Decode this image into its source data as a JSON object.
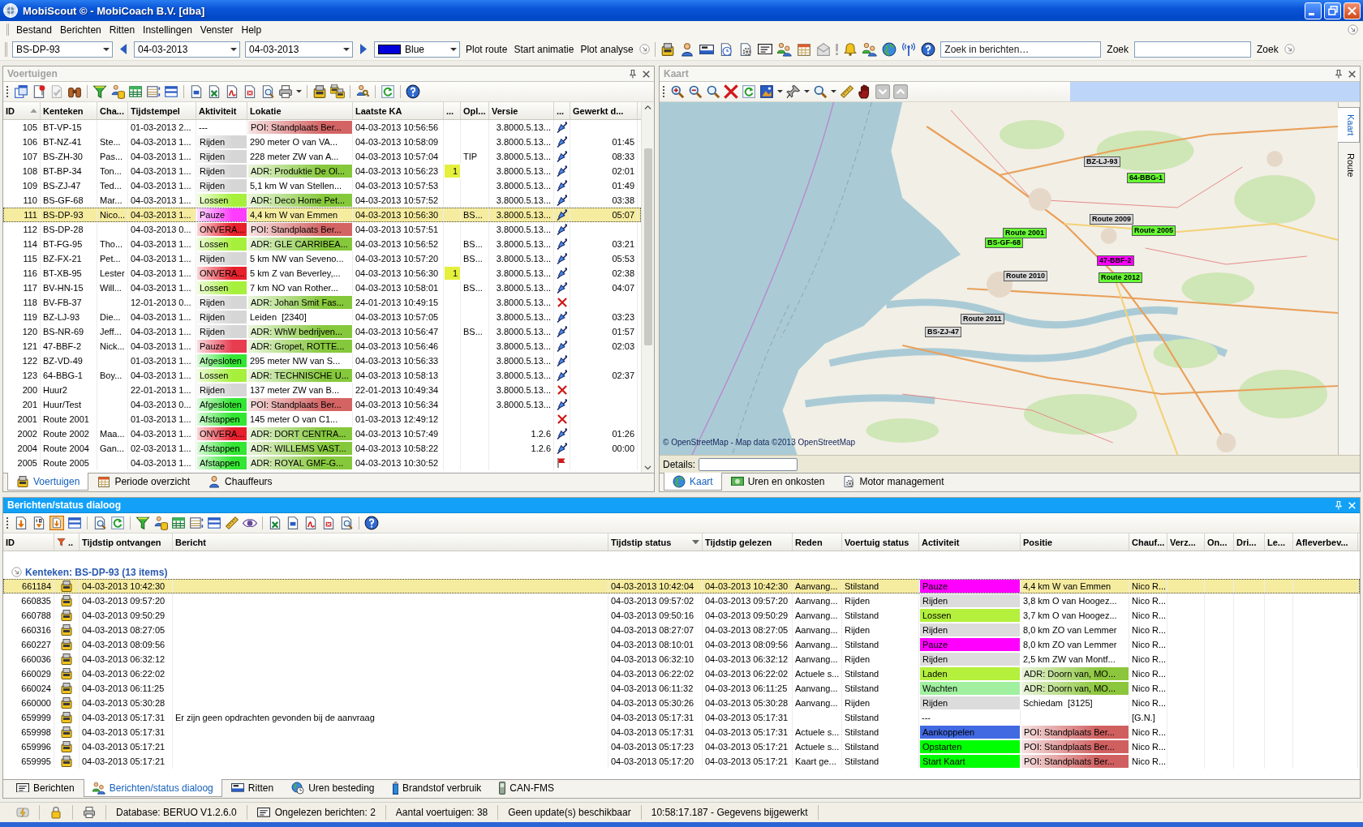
{
  "window": {
    "title": "MobiScout © - MobiCoach B.V. [dba]"
  },
  "menu": [
    "Bestand",
    "Berichten",
    "Ritten",
    "Instellingen",
    "Venster",
    "Help"
  ],
  "toolbar": {
    "vehicle": "BS-DP-93",
    "date_from": "04-03-2013",
    "date_to": "04-03-2013",
    "route_color": "Blue",
    "actions": [
      "Plot route",
      "Start animatie",
      "Plot analyse"
    ],
    "search": [
      {
        "placeholder": "Zoek in berichten…",
        "button": "Zoek"
      },
      {
        "button": "Zoek"
      }
    ]
  },
  "vehicles": {
    "title": "Voertuigen",
    "active": false,
    "columns": [
      {
        "label": "ID",
        "sorted": true,
        "ascending": true
      },
      {
        "label": "Kenteken"
      },
      {
        "label": "Cha..."
      },
      {
        "label": "Tijdstempel"
      },
      {
        "label": "Aktiviteit"
      },
      {
        "label": "Lokatie"
      },
      {
        "label": "Laatste KA"
      },
      {
        "label": "..."
      },
      {
        "label": "Opl..."
      },
      {
        "label": "Versie"
      },
      {
        "label": "..."
      },
      {
        "label": "Gewerkt d..."
      }
    ],
    "rows": [
      {
        "id": "105",
        "kenteken": "BT-VP-15",
        "tijdstempel": "01-03-2013 2...",
        "aktiviteit": {
          "text": "---"
        },
        "lokatie": {
          "text": "POI: Standplaats Ber...",
          "color": "#d46464"
        },
        "laatste_ka": "04-03-2013 10:56:56",
        "versie": "3.8000.5.13...",
        "column_11": {
          "kind": "pen"
        },
        "selected": false
      },
      {
        "id": "106",
        "kenteken": "BT-NZ-41",
        "column_3": "Ste...",
        "tijdstempel": "04-03-2013 1...",
        "aktiviteit": {
          "text": "Rijden",
          "color": "#d6d6d6"
        },
        "lokatie": {
          "text": "290 meter O van VA..."
        },
        "laatste_ka": "04-03-2013 10:58:09",
        "versie": "3.8000.5.13...",
        "column_11": {
          "kind": "pen"
        },
        "column_12": "01:45",
        "selected": false
      },
      {
        "id": "107",
        "kenteken": "BS-ZH-30",
        "column_3": "Pas...",
        "tijdstempel": "04-03-2013 1...",
        "aktiviteit": {
          "text": "Rijden",
          "color": "#d6d6d6"
        },
        "lokatie": {
          "text": "228 meter ZW van A..."
        },
        "laatste_ka": "04-03-2013 10:57:04",
        "column_9": "TIP",
        "versie": "3.8000.5.13...",
        "column_11": {
          "kind": "pen"
        },
        "column_12": "08:33",
        "selected": false
      },
      {
        "id": "108",
        "kenteken": "BT-BP-34",
        "column_3": "Ton...",
        "tijdstempel": "04-03-2013 1...",
        "aktiviteit": {
          "text": "Rijden",
          "color": "#d6d6d6"
        },
        "lokatie": {
          "text": "ADR: Produktie De Ol...",
          "color": "#86c83c"
        },
        "laatste_ka": "04-03-2013 10:56:23",
        "column_8": "1",
        "versie": "3.8000.5.13...",
        "column_11": {
          "kind": "pen"
        },
        "column_12": "02:01",
        "selected": false
      },
      {
        "id": "109",
        "kenteken": "BS-ZJ-47",
        "column_3": "Ted...",
        "tijdstempel": "04-03-2013 1...",
        "aktiviteit": {
          "text": "Rijden",
          "color": "#d6d6d6"
        },
        "lokatie": {
          "text": "5,1 km W van Stellen..."
        },
        "laatste_ka": "04-03-2013 10:57:53",
        "versie": "3.8000.5.13...",
        "column_11": {
          "kind": "pen"
        },
        "column_12": "01:49",
        "selected": false
      },
      {
        "id": "110",
        "kenteken": "BS-GF-68",
        "column_3": "Mar...",
        "tijdstempel": "04-03-2013 1...",
        "aktiviteit": {
          "text": "Lossen",
          "color": "#a6f03c"
        },
        "lokatie": {
          "text": "ADR: Deco Home Pet...",
          "color": "#86c83c"
        },
        "laatste_ka": "04-03-2013 10:57:52",
        "versie": "3.8000.5.13...",
        "column_11": {
          "kind": "pen"
        },
        "column_12": "03:38",
        "selected": false
      },
      {
        "id": "111",
        "kenteken": "BS-DP-93",
        "column_3": "Nico...",
        "tijdstempel": "04-03-2013 1...",
        "aktiviteit": {
          "text": "Pauze",
          "color": "#ff3cff"
        },
        "lokatie": {
          "text": "4,4 km W van Emmen"
        },
        "laatste_ka": "04-03-2013 10:56:30",
        "column_9": "BS...",
        "versie": "3.8000.5.13...",
        "column_11": {
          "kind": "pen"
        },
        "column_12": "05:07",
        "selected": true
      },
      {
        "id": "112",
        "kenteken": "BS-DP-28",
        "tijdstempel": "04-03-2013 0...",
        "aktiviteit": {
          "text": "ONVERA...",
          "color": "#e8202c"
        },
        "lokatie": {
          "text": "POI: Standplaats Ber...",
          "color": "#d46464"
        },
        "laatste_ka": "04-03-2013 10:57:51",
        "versie": "3.8000.5.13...",
        "column_11": {
          "kind": "pen"
        },
        "selected": false
      },
      {
        "id": "114",
        "kenteken": "BT-FG-95",
        "column_3": "Tho...",
        "tijdstempel": "04-03-2013 1...",
        "aktiviteit": {
          "text": "Lossen",
          "color": "#a6f03c"
        },
        "lokatie": {
          "text": "ADR: GLE CARRIBEA...",
          "color": "#86c83c"
        },
        "laatste_ka": "04-03-2013 10:56:52",
        "column_9": "BS...",
        "versie": "3.8000.5.13...",
        "column_11": {
          "kind": "pen"
        },
        "column_12": "03:21",
        "selected": false
      },
      {
        "id": "115",
        "kenteken": "BZ-FX-21",
        "column_3": "Pet...",
        "tijdstempel": "04-03-2013 1...",
        "aktiviteit": {
          "text": "Rijden",
          "color": "#d6d6d6"
        },
        "lokatie": {
          "text": "5 km NW van Seveno..."
        },
        "laatste_ka": "04-03-2013 10:57:20",
        "column_9": "BS...",
        "versie": "3.8000.5.13...",
        "column_11": {
          "kind": "pen"
        },
        "column_12": "05:53",
        "selected": false
      },
      {
        "id": "116",
        "kenteken": "BT-XB-95",
        "column_3": "Lester",
        "tijdstempel": "04-03-2013 1...",
        "aktiviteit": {
          "text": "ONVERA...",
          "color": "#e8202c"
        },
        "lokatie": {
          "text": "5 km Z van Beverley,..."
        },
        "laatste_ka": "04-03-2013 10:56:30",
        "column_8": "1",
        "versie": "3.8000.5.13...",
        "column_11": {
          "kind": "pen"
        },
        "column_12": "02:38",
        "selected": false
      },
      {
        "id": "117",
        "kenteken": "BV-HN-15",
        "column_3": "Will...",
        "tijdstempel": "04-03-2013 1...",
        "aktiviteit": {
          "text": "Lossen",
          "color": "#a6f03c"
        },
        "lokatie": {
          "text": "7 km NO van Rother..."
        },
        "laatste_ka": "04-03-2013 10:58:01",
        "column_9": "BS...",
        "versie": "3.8000.5.13...",
        "column_11": {
          "kind": "pen"
        },
        "column_12": "04:07",
        "selected": false
      },
      {
        "id": "118",
        "kenteken": "BV-FB-37",
        "tijdstempel": "12-01-2013 0...",
        "aktiviteit": {
          "text": "Rijden",
          "color": "#d6d6d6"
        },
        "lokatie": {
          "text": "ADR: Johan Smit Fas...",
          "color": "#86c83c"
        },
        "laatste_ka": "24-01-2013 10:49:15",
        "versie": "3.8000.5.13...",
        "column_11": {
          "kind": "cross"
        },
        "selected": false
      },
      {
        "id": "119",
        "kenteken": "BZ-LJ-93",
        "column_3": "Die...",
        "tijdstempel": "04-03-2013 1...",
        "aktiviteit": {
          "text": "Rijden",
          "color": "#d6d6d6"
        },
        "lokatie": {
          "text": "Leiden  [2340]"
        },
        "laatste_ka": "04-03-2013 10:57:05",
        "versie": "3.8000.5.13...",
        "column_11": {
          "kind": "pen"
        },
        "column_12": "03:23",
        "selected": false
      },
      {
        "id": "120",
        "kenteken": "BS-NR-69",
        "column_3": "Jeff...",
        "tijdstempel": "04-03-2013 1...",
        "aktiviteit": {
          "text": "Rijden",
          "color": "#d6d6d6"
        },
        "lokatie": {
          "text": "ADR: WhW bedrijven...",
          "color": "#86c83c"
        },
        "laatste_ka": "04-03-2013 10:56:47",
        "column_9": "BS...",
        "versie": "3.8000.5.13...",
        "column_11": {
          "kind": "pen"
        },
        "column_12": "01:57",
        "selected": false
      },
      {
        "id": "121",
        "kenteken": "47-BBF-2",
        "column_3": "Nick...",
        "tijdstempel": "04-03-2013 1...",
        "aktiviteit": {
          "text": "Pauze",
          "color": "#e83c50"
        },
        "lokatie": {
          "text": "ADR: Gropet, ROTTE...",
          "color": "#86c83c"
        },
        "laatste_ka": "04-03-2013 10:56:46",
        "versie": "3.8000.5.13...",
        "column_11": {
          "kind": "pen"
        },
        "column_12": "02:03",
        "selected": false
      },
      {
        "id": "122",
        "kenteken": "BZ-VD-49",
        "tijdstempel": "01-03-2013 1...",
        "aktiviteit": {
          "text": "Afgesloten",
          "color": "#32e632"
        },
        "lokatie": {
          "text": "295 meter NW van S..."
        },
        "laatste_ka": "04-03-2013 10:56:33",
        "versie": "3.8000.5.13...",
        "column_11": {
          "kind": "pen"
        },
        "selected": false
      },
      {
        "id": "123",
        "kenteken": "64-BBG-1",
        "column_3": "Boy...",
        "tijdstempel": "04-03-2013 1...",
        "aktiviteit": {
          "text": "Lossen",
          "color": "#a6f03c"
        },
        "lokatie": {
          "text": "ADR: TECHNISCHE U...",
          "color": "#86c83c"
        },
        "laatste_ka": "04-03-2013 10:58:13",
        "versie": "3.8000.5.13...",
        "column_11": {
          "kind": "pen"
        },
        "column_12": "02:37",
        "selected": false
      },
      {
        "id": "200",
        "kenteken": "Huur2",
        "tijdstempel": "22-01-2013 1...",
        "aktiviteit": {
          "text": "Rijden",
          "color": "#d6d6d6"
        },
        "lokatie": {
          "text": "137 meter ZW van B..."
        },
        "laatste_ka": "22-01-2013 10:49:34",
        "versie": "3.8000.5.13...",
        "column_11": {
          "kind": "cross"
        },
        "selected": false
      },
      {
        "id": "201",
        "kenteken": "Huur/Test",
        "tijdstempel": "04-03-2013 0...",
        "aktiviteit": {
          "text": "Afgesloten",
          "color": "#32e632"
        },
        "lokatie": {
          "text": "POI: Standplaats Ber...",
          "color": "#d46464"
        },
        "laatste_ka": "04-03-2013 10:56:34",
        "versie": "3.8000.5.13...",
        "column_11": {
          "kind": "pen"
        },
        "selected": false
      },
      {
        "id": "2001",
        "kenteken": "Route 2001",
        "tijdstempel": "01-03-2013 1...",
        "aktiviteit": {
          "text": "Afstappen",
          "color": "#32e632"
        },
        "lokatie": {
          "text": "145 meter O van C1..."
        },
        "laatste_ka": "01-03-2013 12:49:12",
        "column_11": {
          "kind": "cross"
        },
        "selected": false
      },
      {
        "id": "2002",
        "kenteken": "Route 2002",
        "column_3": "Maa...",
        "tijdstempel": "04-03-2013 1...",
        "aktiviteit": {
          "text": "ONVERA...",
          "color": "#e8202c"
        },
        "lokatie": {
          "text": "ADR: DORT CENTRA...",
          "color": "#86c83c"
        },
        "laatste_ka": "04-03-2013 10:57:49",
        "versie": "1.2.6",
        "column_11": {
          "kind": "pen"
        },
        "column_12": "01:26",
        "selected": false
      },
      {
        "id": "2004",
        "kenteken": "Route 2004",
        "column_3": "Gan...",
        "tijdstempel": "02-03-2013 1...",
        "aktiviteit": {
          "text": "Afstappen",
          "color": "#32e632"
        },
        "lokatie": {
          "text": "ADR: WILLEMS VAST...",
          "color": "#86c83c"
        },
        "laatste_ka": "04-03-2013 10:58:22",
        "versie": "1.2.6",
        "column_11": {
          "kind": "pen"
        },
        "column_12": "00:00",
        "selected": false
      },
      {
        "id": "2005",
        "kenteken": "Route 2005",
        "tijdstempel": "04-03-2013 1...",
        "aktiviteit": {
          "text": "Afstappen",
          "color": "#32e632"
        },
        "lokatie": {
          "text": "ADR: ROYAL GMF-G...",
          "color": "#86c83c"
        },
        "laatste_ka": "04-03-2013 10:30:52",
        "column_11": {
          "kind": "flag"
        },
        "selected": false
      }
    ],
    "tabs": [
      {
        "label": "Voertuigen",
        "selected": true
      },
      {
        "label": "Periode overzicht",
        "selected": false
      },
      {
        "label": "Chauffeurs",
        "selected": false
      }
    ]
  },
  "map": {
    "title": "Kaart",
    "active": false,
    "side_tabs": [
      {
        "label": "Kaart",
        "selected": true
      },
      {
        "label": "Route",
        "selected": false
      }
    ],
    "markers": [
      {
        "label": "BZ-LJ-93",
        "color": "#d8d8d8"
      },
      {
        "label": "64-BBG-1",
        "color": "#66ff33"
      },
      {
        "label": "BS-GF-68",
        "color": "#66ff33"
      },
      {
        "label": "47-BBF-2",
        "color": "#ff00ff"
      },
      {
        "label": "BS-ZJ-47",
        "color": "#d8d8d8"
      },
      {
        "label": "Route 2001",
        "color": "#66ff33"
      },
      {
        "label": "Route 2005",
        "color": "#66ff33"
      },
      {
        "label": "Route 2010",
        "color": "#d8d8d8"
      },
      {
        "label": "Route 2012",
        "color": "#66ff33"
      },
      {
        "label": "Route 2011",
        "color": "#d8d8d8"
      },
      {
        "label": "Route 2009",
        "color": "#d8d8d8"
      }
    ],
    "attribution": "© OpenStreetMap - Map data ©2013 OpenStreetMap",
    "details_label": "Details:",
    "tabs": [
      {
        "label": "Kaart",
        "selected": true
      },
      {
        "label": "Uren en onkosten",
        "selected": false
      },
      {
        "label": "Motor management",
        "selected": false
      }
    ]
  },
  "messages": {
    "title": "Berichten/status dialoog",
    "active": true,
    "columns": [
      {
        "label": "ID"
      },
      {
        "label": ".."
      },
      {
        "label": "Tijdstip ontvangen"
      },
      {
        "label": "Bericht"
      },
      {
        "label": "Tijdstip status",
        "sorted": true,
        "ascending": false
      },
      {
        "label": "Tijdstip gelezen"
      },
      {
        "label": "Reden"
      },
      {
        "label": "Voertuig status"
      },
      {
        "label": "Activiteit"
      },
      {
        "label": "Positie"
      },
      {
        "label": "Chauf..."
      },
      {
        "label": "Verz..."
      },
      {
        "label": "On..."
      },
      {
        "label": "Dri..."
      },
      {
        "label": "Le..."
      },
      {
        "label": "Afleverbev..."
      }
    ],
    "group": {
      "label": "Kenteken: BS-DP-93 (13 items)",
      "expanded": true
    },
    "rows": [
      {
        "id": "661184",
        "tijdstip_ontvangen": "04-03-2013 10:42:30",
        "tijdstip_status": "04-03-2013 10:42:04",
        "tijdstip_gelezen": "04-03-2013 10:42:30",
        "reden": "Aanvang...",
        "voertuig_status": "Stilstand",
        "activiteit": {
          "text": "Pauze",
          "color": "#ff00ff"
        },
        "positie": {
          "text": "4,4 km W van Emmen"
        },
        "column_11": "Nico R...",
        "selected": true
      },
      {
        "id": "660835",
        "tijdstip_ontvangen": "04-03-2013 09:57:20",
        "tijdstip_status": "04-03-2013 09:57:02",
        "tijdstip_gelezen": "04-03-2013 09:57:20",
        "reden": "Aanvang...",
        "voertuig_status": "Rijden",
        "activiteit": {
          "text": "Rijden",
          "color": "#dcdcdc"
        },
        "positie": {
          "text": "3,8 km O van Hoogez..."
        },
        "column_11": "Nico R...",
        "selected": false
      },
      {
        "id": "660788",
        "tijdstip_ontvangen": "04-03-2013 09:50:29",
        "tijdstip_status": "04-03-2013 09:50:16",
        "tijdstip_gelezen": "04-03-2013 09:50:29",
        "reden": "Aanvang...",
        "voertuig_status": "Stilstand",
        "activiteit": {
          "text": "Lossen",
          "color": "#b4f03c"
        },
        "positie": {
          "text": "3,7 km O van Hoogez..."
        },
        "column_11": "Nico R...",
        "selected": false
      },
      {
        "id": "660316",
        "tijdstip_ontvangen": "04-03-2013 08:27:05",
        "tijdstip_status": "04-03-2013 08:27:07",
        "tijdstip_gelezen": "04-03-2013 08:27:05",
        "reden": "Aanvang...",
        "voertuig_status": "Rijden",
        "activiteit": {
          "text": "Rijden",
          "color": "#dcdcdc"
        },
        "positie": {
          "text": "8,0 km ZO van Lemmer"
        },
        "column_11": "Nico R...",
        "selected": false
      },
      {
        "id": "660227",
        "tijdstip_ontvangen": "04-03-2013 08:09:56",
        "tijdstip_status": "04-03-2013 08:10:01",
        "tijdstip_gelezen": "04-03-2013 08:09:56",
        "reden": "Aanvang...",
        "voertuig_status": "Stilstand",
        "activiteit": {
          "text": "Pauze",
          "color": "#ff00ff"
        },
        "positie": {
          "text": "8,0 km ZO van Lemmer"
        },
        "column_11": "Nico R...",
        "selected": false
      },
      {
        "id": "660036",
        "tijdstip_ontvangen": "04-03-2013 06:32:12",
        "tijdstip_status": "04-03-2013 06:32:10",
        "tijdstip_gelezen": "04-03-2013 06:32:12",
        "reden": "Aanvang...",
        "voertuig_status": "Rijden",
        "activiteit": {
          "text": "Rijden",
          "color": "#dcdcdc"
        },
        "positie": {
          "text": "2,5 km ZW van Montf..."
        },
        "column_11": "Nico R...",
        "selected": false
      },
      {
        "id": "660029",
        "tijdstip_ontvangen": "04-03-2013 06:22:02",
        "tijdstip_status": "04-03-2013 06:22:02",
        "tijdstip_gelezen": "04-03-2013 06:22:02",
        "reden": "Actuele s...",
        "voertuig_status": "Stilstand",
        "activiteit": {
          "text": "Laden",
          "color": "#b4f03c"
        },
        "positie": {
          "text": "ADR: Doorn van, MO...",
          "color": "#8cc63c"
        },
        "column_11": "Nico R...",
        "selected": false
      },
      {
        "id": "660024",
        "tijdstip_ontvangen": "04-03-2013 06:11:25",
        "tijdstip_status": "04-03-2013 06:11:32",
        "tijdstip_gelezen": "04-03-2013 06:11:25",
        "reden": "Aanvang...",
        "voertuig_status": "Stilstand",
        "activiteit": {
          "text": "Wachten",
          "color": "#a0f0a0"
        },
        "positie": {
          "text": "ADR: Doorn van, MO...",
          "color": "#8cc63c"
        },
        "column_11": "Nico R...",
        "selected": false
      },
      {
        "id": "660000",
        "tijdstip_ontvangen": "04-03-2013 05:30:28",
        "tijdstip_status": "04-03-2013 05:30:26",
        "tijdstip_gelezen": "04-03-2013 05:30:28",
        "reden": "Aanvang...",
        "voertuig_status": "Rijden",
        "activiteit": {
          "text": "Rijden",
          "color": "#dcdcdc"
        },
        "positie": {
          "text": "Schiedam  [3125]"
        },
        "column_11": "Nico R...",
        "selected": false
      },
      {
        "id": "659999",
        "tijdstip_ontvangen": "04-03-2013 05:17:31",
        "bericht": "Er zijn geen opdrachten gevonden bij de aanvraag",
        "tijdstip_status": "04-03-2013 05:17:31",
        "tijdstip_gelezen": "04-03-2013 05:17:31",
        "voertuig_status": "Stilstand",
        "activiteit": {
          "text": "---"
        },
        "column_11": "[G.N.]",
        "selected": false
      },
      {
        "id": "659998",
        "tijdstip_ontvangen": "04-03-2013 05:17:31",
        "tijdstip_status": "04-03-2013 05:17:31",
        "tijdstip_gelezen": "04-03-2013 05:17:31",
        "reden": "Actuele s...",
        "voertuig_status": "Stilstand",
        "activiteit": {
          "text": "Aankoppelen",
          "color": "#4169e1"
        },
        "positie": {
          "text": "POI: Standplaats Ber...",
          "color": "#d06060"
        },
        "column_11": "Nico R...",
        "selected": false
      },
      {
        "id": "659996",
        "tijdstip_ontvangen": "04-03-2013 05:17:21",
        "tijdstip_status": "04-03-2013 05:17:23",
        "tijdstip_gelezen": "04-03-2013 05:17:21",
        "reden": "Actuele s...",
        "voertuig_status": "Stilstand",
        "activiteit": {
          "text": "Opstarten",
          "color": "#00ff00"
        },
        "positie": {
          "text": "POI: Standplaats Ber...",
          "color": "#d06060"
        },
        "column_11": "Nico R...",
        "selected": false
      },
      {
        "id": "659995",
        "tijdstip_ontvangen": "04-03-2013 05:17:21",
        "tijdstip_status": "04-03-2013 05:17:20",
        "tijdstip_gelezen": "04-03-2013 05:17:21",
        "reden": "Kaart ge...",
        "voertuig_status": "Stilstand",
        "activiteit": {
          "text": "Start Kaart",
          "color": "#00ff00"
        },
        "positie": {
          "text": "POI: Standplaats Ber...",
          "color": "#d06060"
        },
        "column_11": "Nico R...",
        "selected": false
      }
    ],
    "tabs": [
      {
        "label": "Berichten",
        "selected": false
      },
      {
        "label": "Berichten/status dialoog",
        "selected": true
      },
      {
        "label": "Ritten",
        "selected": false
      },
      {
        "label": "Uren besteding",
        "selected": false
      },
      {
        "label": "Brandstof verbruik",
        "selected": false
      },
      {
        "label": "CAN-FMS",
        "selected": false
      }
    ]
  },
  "status_bar": [
    {
      "text": "Database: BERUO V1.2.6.0",
      "kind": "text"
    },
    {
      "text": "Ongelezen berichten: 2",
      "kind": "mail"
    },
    {
      "text": "Aantal voertuigen: 38",
      "kind": "text"
    },
    {
      "text": "Geen update(s) beschikbaar",
      "kind": "text"
    },
    {
      "text": "10:58:17.187 - Gegevens bijgewerkt",
      "kind": "text"
    }
  ]
}
